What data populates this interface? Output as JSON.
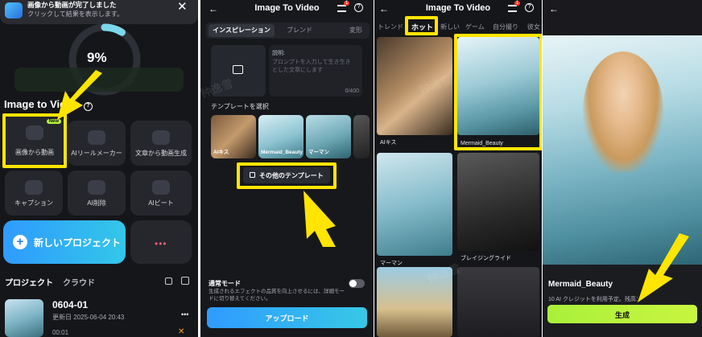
{
  "panel1": {
    "notification_title": "画像から動画が完了しました",
    "notification_subtitle": "クリックして結果を表示します。",
    "progress_percent": "9%",
    "progress_value": 0.09,
    "section_title": "Image to Video",
    "new_badge": "New",
    "tiles": [
      {
        "label": "画像から動画",
        "icon": "image-video-icon"
      },
      {
        "label": "AIリールメーカー",
        "icon": "lightning-icon"
      },
      {
        "label": "文章から動画生成",
        "icon": "magic-wand-icon"
      },
      {
        "label": "キャプション",
        "icon": "cc-icon"
      },
      {
        "label": "AI削除",
        "icon": "eraser-icon"
      },
      {
        "label": "AIビート",
        "icon": "beat-icon"
      }
    ],
    "new_project_label": "新しいプロジェクト",
    "tab_projects": "プロジェクト",
    "tab_cloud": "クラウド",
    "project": {
      "name": "0604-01",
      "updated": "更新日 2025-06-04 20:43",
      "duration": "00:01"
    }
  },
  "panel2": {
    "title": "Image To Video",
    "badge": "1",
    "tabs": [
      "インスピレーション",
      "ブレンド",
      "変形"
    ],
    "description_label": "説明:",
    "description_placeholder": "プロンプトを入力して生き生きとした文章にします",
    "char_count": "0/400",
    "template_section": "テンプレートを選択",
    "templates": [
      "AIキス",
      "Mermaid_Beauty",
      "マーマン",
      ""
    ],
    "more_templates": "その他のテンプレート",
    "normal_mode_title": "通常モード",
    "normal_mode_desc": "生成されるエフェクトの品質を向上させるには、詳細モードに切り替えてください。",
    "upload_label": "アップロード"
  },
  "panel3": {
    "title": "Image To Video",
    "badge": "1",
    "tabs": [
      "トレンド",
      "ホット",
      "新しい",
      "ゲーム",
      "自分撮り",
      "彼女"
    ],
    "cards": [
      "AIキス",
      "Mermaid_Beauty",
      "マーマン",
      "ブレイジングライド",
      "",
      ""
    ]
  },
  "panel4": {
    "template_name": "Mermaid_Beauty",
    "credit_text": "10 AI クレジットを利用予定。残高：",
    "generate_label": "生成"
  },
  "watermark": "钟逸雪",
  "colors": {
    "highlight": "#ffe500",
    "accent_blue": "#3aa8ff",
    "generate_green": "#b8f23a"
  }
}
